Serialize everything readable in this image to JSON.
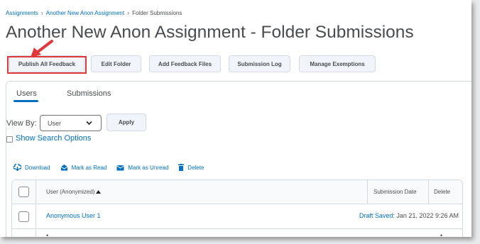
{
  "breadcrumb": {
    "items": [
      "Assignments",
      "Another New Anon Assignment",
      "Folder Submissions"
    ]
  },
  "page": {
    "title": "Another New Anon Assignment - Folder Submissions"
  },
  "toolbar": {
    "publish_all_feedback": "Publish All Feedback",
    "edit_folder": "Edit Folder",
    "add_feedback_files": "Add Feedback Files",
    "submission_log": "Submission Log",
    "manage_exemptions": "Manage Exemptions"
  },
  "tabs": [
    {
      "label": "Users",
      "selected": true
    },
    {
      "label": "Submissions",
      "selected": false
    }
  ],
  "filter": {
    "view_by_label": "View By:",
    "view_by_value": "User",
    "apply_label": "Apply",
    "search_options_label": "Show Search Options"
  },
  "actions": {
    "download": "Download",
    "mark_read": "Mark as Read",
    "mark_unread": "Mark as Unread",
    "delete": "Delete"
  },
  "table": {
    "columns": {
      "user": "User (Anonymized)",
      "submission_date": "Submission Date",
      "delete": "Delete"
    },
    "rows": [
      {
        "user": "Anonymous User 1",
        "status": "Draft Saved:",
        "date": "Jan 21, 2022 9:26 AM"
      }
    ]
  },
  "colors": {
    "link": "#006fbf",
    "highlight": "#e0373a",
    "text": "#494c4e"
  },
  "icons": {
    "download": "download-icon",
    "mark_read": "envelope-open-icon",
    "mark_unread": "envelope-icon",
    "delete": "trash-icon",
    "sort": "sort-ascending-icon",
    "select": "chevron-down-icon"
  }
}
